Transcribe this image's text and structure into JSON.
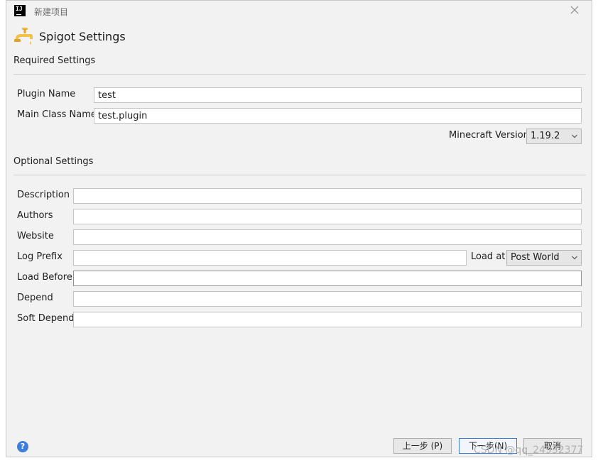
{
  "window": {
    "title": "新建项目"
  },
  "header": {
    "title": "Spigot Settings",
    "icon": "spigot-faucet-icon"
  },
  "required": {
    "section_title": "Required Settings",
    "plugin_name_label": "Plugin Name",
    "plugin_name_value": "test",
    "main_class_label": "Main Class Name",
    "main_class_value": "test.plugin",
    "minecraft_version_label": "Minecraft Version",
    "minecraft_version_value": "1.19.2"
  },
  "optional": {
    "section_title": "Optional Settings",
    "description_label": "Description",
    "description_value": "",
    "authors_label": "Authors",
    "authors_value": "",
    "website_label": "Website",
    "website_value": "",
    "log_prefix_label": "Log Prefix",
    "log_prefix_value": "",
    "load_at_label": "Load at",
    "load_at_value": "Post World",
    "load_before_label": "Load Before",
    "load_before_value": "",
    "depend_label": "Depend",
    "depend_value": "",
    "soft_depend_label": "Soft Depend",
    "soft_depend_value": ""
  },
  "footer": {
    "help_label": "?",
    "previous_label": "上一步 (P)",
    "next_label": "下一步(N)",
    "cancel_label": "取消"
  },
  "watermark": "CSDN @qq_24932377",
  "colors": {
    "accent": "#3c7fd4",
    "background": "#f2f2f2"
  }
}
